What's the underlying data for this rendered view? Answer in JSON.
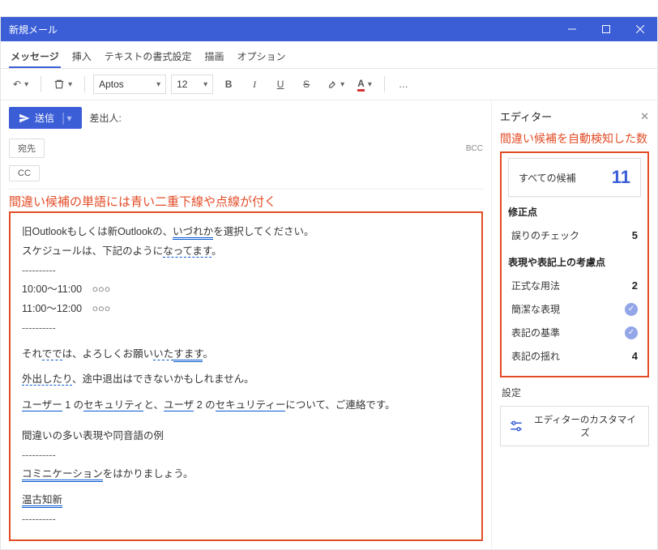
{
  "titlebar": {
    "title": "新規メール"
  },
  "tabs": {
    "message": "メッセージ",
    "insert": "挿入",
    "format": "テキストの書式設定",
    "draw": "描画",
    "options": "オプション"
  },
  "toolbar": {
    "font_name": "Aptos",
    "font_size": "12",
    "bold": "B",
    "italic": "I",
    "underline": "U",
    "strike": "S",
    "ellipsis": "…"
  },
  "compose": {
    "send": "送信",
    "from_label": "差出人:",
    "to": "宛先",
    "cc": "CC",
    "bcc": "BCC"
  },
  "annotations": {
    "body_note": "間違い候補の単語には青い二重下線や点線が付く",
    "count_note": "間違い候補を自動検知した数"
  },
  "body": {
    "line1_pre": "旧Outlookもしくは新Outlookの、",
    "line1_err": "いづれか",
    "line1_post": "を選択してください。",
    "line2_pre": "スケジュールは、下記のように",
    "line2_err": "なってます",
    "line2_post": "。",
    "dash": "----------",
    "sched1": "10:00～11:00　○○○",
    "sched2": "11:00～12:00　○○○",
    "line3_pre": "それ",
    "line3_err1": "でで",
    "line3_mid": "は、よろしくお願い",
    "line3_err2": "いた",
    "line3_err3": "すます",
    "line3_post": "。",
    "line4_err": "外出したり",
    "line4_post": "、途中退出はできないかもしれません。",
    "line5_u1": "ユーザー",
    "line5_t1": " 1 の",
    "line5_u2": "セキュリティ",
    "line5_t2": "と、",
    "line5_u3": "ユーザ",
    "line5_t3": " 2 の",
    "line5_u4": "セキュリティー",
    "line5_t4": "について、ご連絡です。",
    "line6": "間違いの多い表現や同音語の例",
    "line7_err": "コミニケーション",
    "line7_post": "をはかりましょう。",
    "line8": "温古知新"
  },
  "side": {
    "title": "エディター",
    "all_suggestions": "すべての候補",
    "all_count": "11",
    "fixes_header": "修正点",
    "typo_check": "誤りのチェック",
    "typo_count": "5",
    "style_header": "表現や表記上の考慮点",
    "formal": "正式な用法",
    "formal_v": "2",
    "concise": "簡潔な表現",
    "standard": "表記の基準",
    "fluctuation": "表記の揺れ",
    "fluctuation_v": "4",
    "settings": "設定",
    "customize": "エディターのカスタマイズ"
  }
}
